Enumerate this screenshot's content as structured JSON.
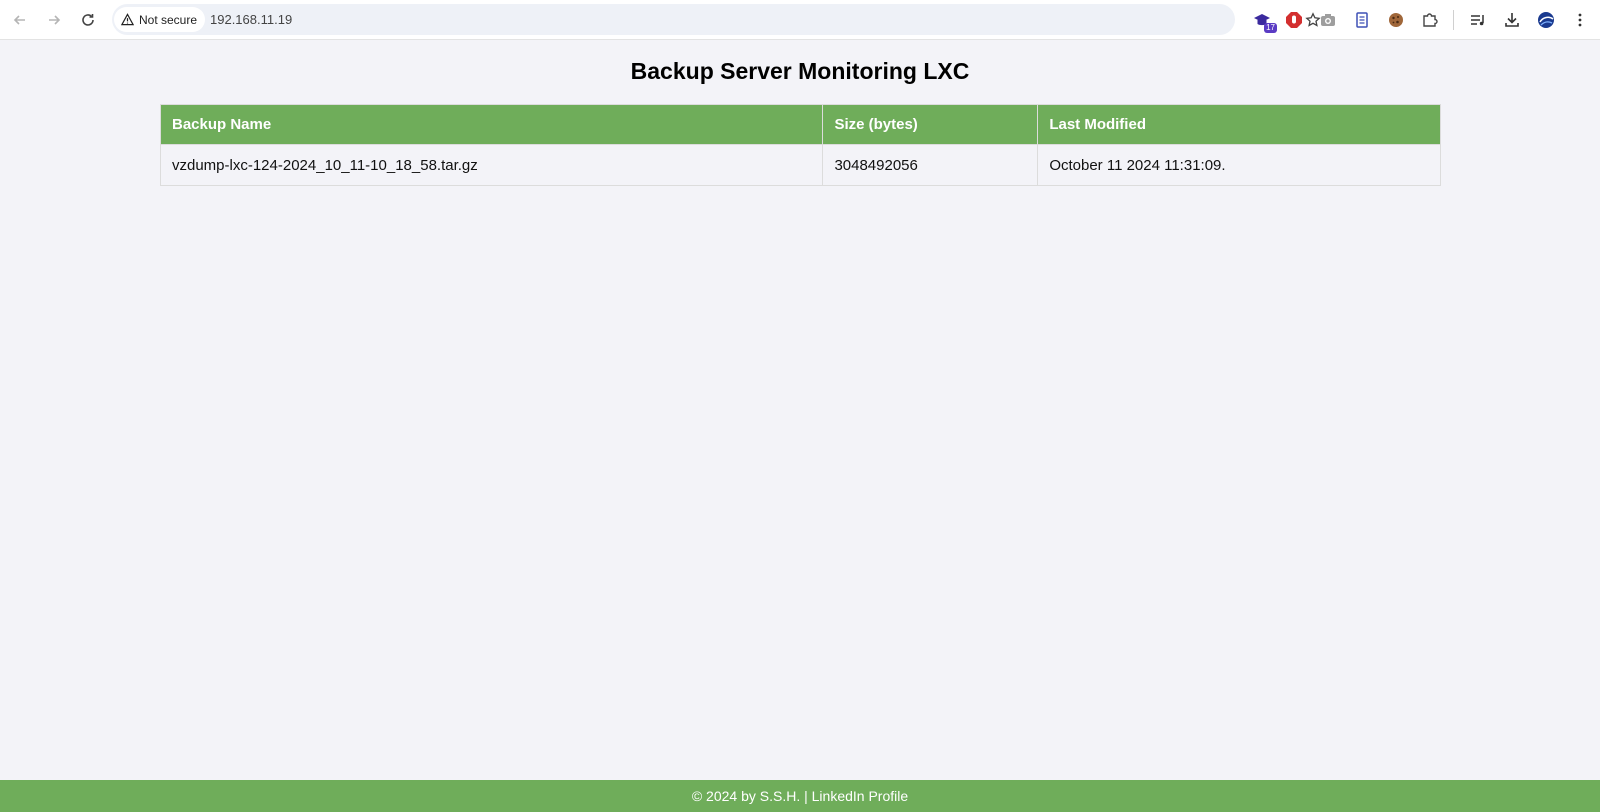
{
  "browser": {
    "security_label": "Not secure",
    "url": "192.168.11.19",
    "extension_badge": "17"
  },
  "page": {
    "title": "Backup Server Monitoring LXC"
  },
  "table": {
    "headers": [
      "Backup Name",
      "Size (bytes)",
      "Last Modified"
    ],
    "rows": [
      [
        "vzdump-lxc-124-2024_10_11-10_18_58.tar.gz",
        "3048492056",
        "October 11 2024 11:31:09."
      ]
    ]
  },
  "footer": {
    "copyright": "© 2024 by S.S.H. | ",
    "link_label": "LinkedIn Profile"
  },
  "colors": {
    "accent_green": "#6fad5a",
    "page_background": "#f3f3f8"
  }
}
